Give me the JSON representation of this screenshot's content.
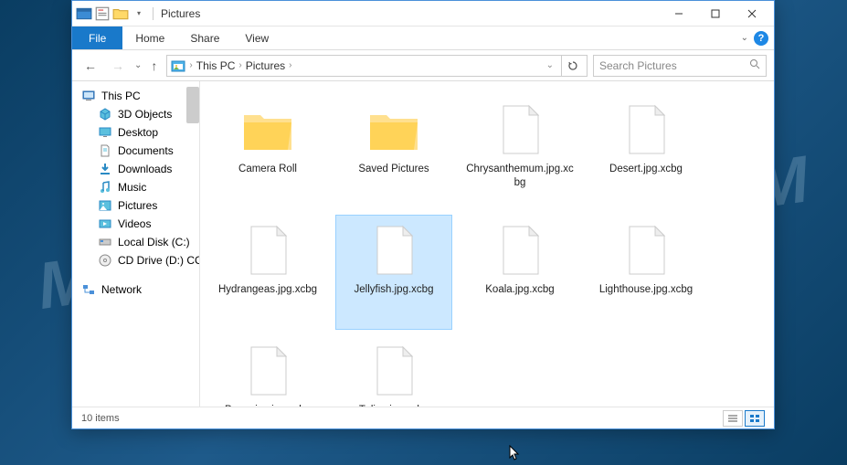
{
  "title": "Pictures",
  "ribbon": {
    "file": "File",
    "tabs": [
      "Home",
      "Share",
      "View"
    ]
  },
  "breadcrumb": {
    "items": [
      "This PC",
      "Pictures"
    ],
    "refresh_dd": "v"
  },
  "search": {
    "placeholder": "Search Pictures"
  },
  "sidebar": {
    "root": "This PC",
    "items": [
      {
        "label": "3D Objects",
        "icon": "3d"
      },
      {
        "label": "Desktop",
        "icon": "desktop"
      },
      {
        "label": "Documents",
        "icon": "documents"
      },
      {
        "label": "Downloads",
        "icon": "downloads"
      },
      {
        "label": "Music",
        "icon": "music"
      },
      {
        "label": "Pictures",
        "icon": "pictures"
      },
      {
        "label": "Videos",
        "icon": "videos"
      },
      {
        "label": "Local Disk (C:)",
        "icon": "disk"
      },
      {
        "label": "CD Drive (D:) CC",
        "icon": "cd"
      }
    ],
    "network": "Network"
  },
  "items": [
    {
      "label": "Camera Roll",
      "type": "folder",
      "selected": false
    },
    {
      "label": "Saved Pictures",
      "type": "folder",
      "selected": false
    },
    {
      "label": "Chrysanthemum.jpg.xcbg",
      "type": "file",
      "selected": false
    },
    {
      "label": "Desert.jpg.xcbg",
      "type": "file",
      "selected": false
    },
    {
      "label": "Hydrangeas.jpg.xcbg",
      "type": "file",
      "selected": false
    },
    {
      "label": "Jellyfish.jpg.xcbg",
      "type": "file",
      "selected": true
    },
    {
      "label": "Koala.jpg.xcbg",
      "type": "file",
      "selected": false
    },
    {
      "label": "Lighthouse.jpg.xcbg",
      "type": "file",
      "selected": false
    },
    {
      "label": "Penguins.jpg.xcbg",
      "type": "file",
      "selected": false
    },
    {
      "label": "Tulips.jpg.xcbg",
      "type": "file",
      "selected": false
    }
  ],
  "status": {
    "count": "10 items"
  }
}
